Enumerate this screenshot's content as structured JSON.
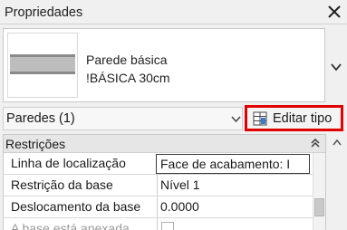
{
  "panel": {
    "title": "Propriedades",
    "close_icon": "close-icon"
  },
  "type_selector": {
    "family": "Parede básica",
    "type": "!BÁSICA 30cm",
    "dropdown_icon": "chevron-down-icon"
  },
  "filter": {
    "selected": "Paredes (1)",
    "edit_type_label": "Editar tipo",
    "edit_type_icon": "edit-type-icon"
  },
  "properties": {
    "group": "Restrições",
    "rows": [
      {
        "name": "Linha de localização",
        "value": "Face de acabamento: I"
      },
      {
        "name": "Restrição da base",
        "value": "Nível 1"
      },
      {
        "name": "Deslocamento da base",
        "value": "0.0000"
      },
      {
        "name": "A base está anexada",
        "value": ""
      }
    ]
  },
  "colors": {
    "highlight_border": "#e00000",
    "panel_bg": "#f0f0f0",
    "group_bg": "#e6e6e6"
  }
}
